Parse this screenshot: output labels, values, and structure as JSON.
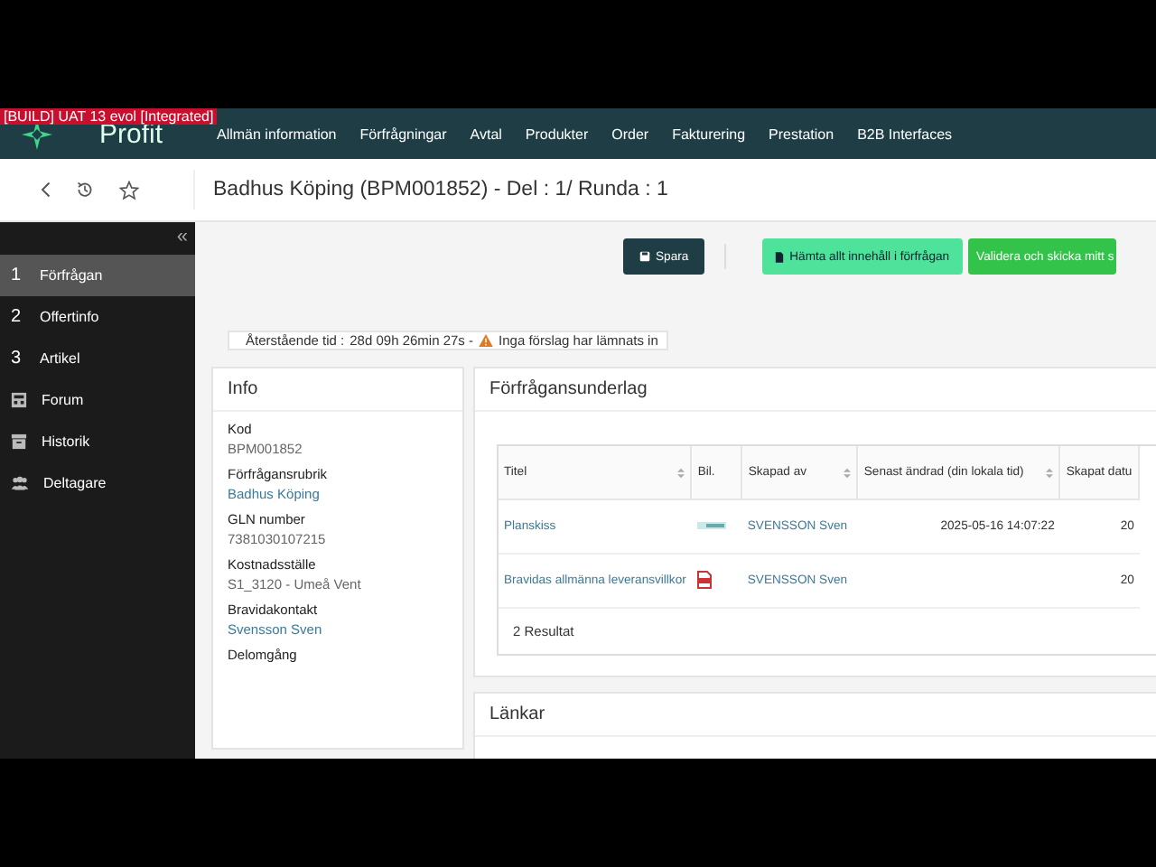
{
  "build_badge": "[BUILD] UAT 13 evol [Integrated]",
  "logo": {
    "text": "Profit"
  },
  "nav": [
    "Allmän information",
    "Förfrågningar",
    "Avtal",
    "Produkter",
    "Order",
    "Fakturering",
    "Prestation",
    "B2B Interfaces"
  ],
  "page_title": "Badhus Köping (BPM001852) - Del : 1/ Runda : 1",
  "sidebar": {
    "collapse": "«",
    "items": [
      {
        "kind": "step",
        "number": "1",
        "label": "Förfrågan",
        "selected": true
      },
      {
        "kind": "step",
        "number": "2",
        "label": "Offertinfo",
        "selected": false
      },
      {
        "kind": "step",
        "number": "3",
        "label": "Artikel",
        "selected": false
      },
      {
        "kind": "board",
        "label": "Forum",
        "selected": false
      },
      {
        "kind": "archive",
        "label": "Historik",
        "selected": false
      },
      {
        "kind": "group",
        "label": "Deltagare",
        "selected": false
      }
    ]
  },
  "toolbar": [
    {
      "kind": "dark",
      "label": "Spara"
    },
    {
      "kind": "light",
      "label": "Hämta allt innehåll i förfrågan"
    },
    {
      "kind": "green",
      "label": "Validera och skicka mitt s"
    }
  ],
  "timer": {
    "label": "Återstående tid :",
    "value": "28d 09h 26min 27s -",
    "warning": "Inga förslag har lämnats in"
  },
  "info": {
    "title": "Info",
    "fields": [
      {
        "label": "Kod",
        "value": "BPM001852",
        "link": false
      },
      {
        "label": "Förfrågansrubrik",
        "value": "Badhus Köping",
        "link": true
      },
      {
        "label": "GLN number",
        "value": "7381030107215",
        "link": false
      },
      {
        "label": "Kostnadsställe",
        "value": "S1_3120 - Umeå Vent",
        "link": false
      },
      {
        "label": "Bravidakontakt",
        "value": "Svensson Sven",
        "link": true
      },
      {
        "label": "Delomgång"
      }
    ]
  },
  "documents": {
    "title": "Förfrågansunderlag",
    "table": {
      "columns": [
        {
          "label": "Titel",
          "sortable": true
        },
        {
          "label": "Bil.",
          "sortable": false
        },
        {
          "label": "Skapad av",
          "sortable": true
        },
        {
          "label": "Senast ändrad (din lokala tid)",
          "sortable": true
        },
        {
          "label": "Skapat datu",
          "sortable": false
        }
      ],
      "rows": [
        {
          "title": "Planskiss",
          "kind": "image",
          "created_by": "SVENSSON Sven",
          "modified": "2025-05-16 14:07:22",
          "created": "20"
        },
        {
          "title": "Bravidas allmänna leveransvillkor",
          "kind": "pdf",
          "created_by": "SVENSSON Sven",
          "created": "20"
        }
      ],
      "footer": "2 Resultat"
    }
  },
  "links": {
    "title": "Länkar"
  }
}
